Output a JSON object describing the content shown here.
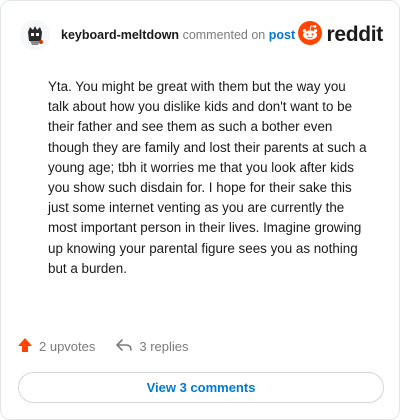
{
  "header": {
    "username": "keyboard-meltdown",
    "commented_text": "commented on",
    "post_link": "post",
    "brand": "reddit"
  },
  "comment": {
    "body": "Yta. You might be great with them but the way you talk about how you dislike kids and don't want to be their father and see them as such a bother even though they are family and lost their parents at such a young age; tbh it worries me that you look after kids you show such disdain for. I hope for their sake this just some internet venting as you are currently the most important person in their lives. Imagine growing up knowing your parental figure sees you as nothing but a burden."
  },
  "footer": {
    "upvotes": "2 upvotes",
    "replies": "3 replies",
    "view_comments": "View 3 comments"
  },
  "colors": {
    "brand_orange": "#ff4500",
    "link_blue": "#0079d3",
    "muted_gray": "#7c7c7c"
  },
  "icons": [
    "avatar",
    "reddit-logo-icon",
    "upvote-arrow-icon",
    "reply-arrow-icon"
  ]
}
